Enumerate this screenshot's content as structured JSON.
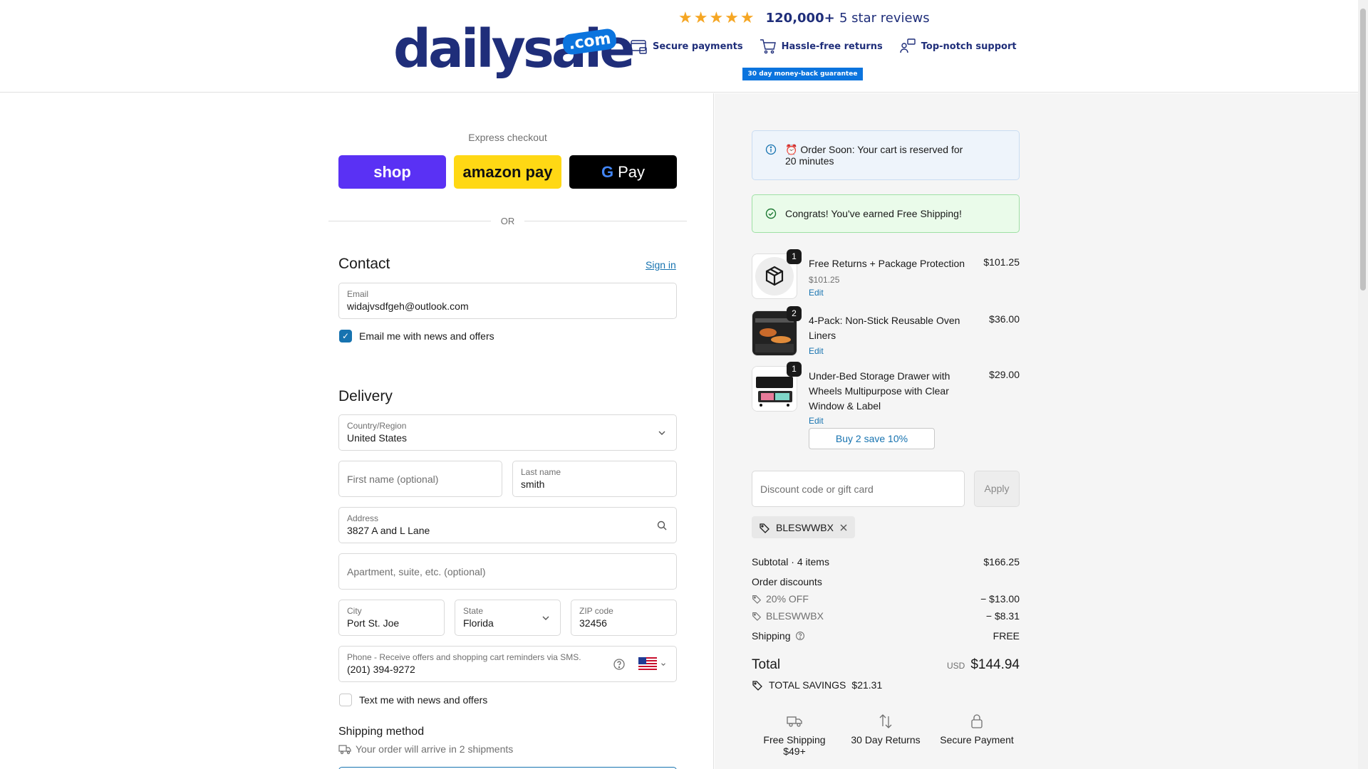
{
  "header": {
    "logo_text": "dailysale",
    "logo_badge": ".com",
    "stars": "★★★★★",
    "reviews_count": "120,000+",
    "reviews_suffix": "5 star reviews",
    "badges": [
      "Secure payments",
      "Hassle-free returns",
      "Top-notch support"
    ],
    "guarantee": "30 day money-back guarantee"
  },
  "express": {
    "label": "Express checkout",
    "shop": "shop",
    "amazon": "amazon pay",
    "google_g": "G",
    "google": "Pay",
    "or": "OR"
  },
  "contact": {
    "title": "Contact",
    "sign_in": "Sign in",
    "email_label": "Email",
    "email_value": "widajvsdfgeh@outlook.com",
    "news_label": "Email me with news and offers",
    "news_checked": true
  },
  "delivery": {
    "title": "Delivery",
    "country_label": "Country/Region",
    "country_value": "United States",
    "first_name_placeholder": "First name (optional)",
    "last_name_label": "Last name",
    "last_name_value": "smith",
    "address_label": "Address",
    "address_value": "3827 A and L Lane",
    "apt_placeholder": "Apartment, suite, etc. (optional)",
    "city_label": "City",
    "city_value": "Port St. Joe",
    "state_label": "State",
    "state_value": "Florida",
    "zip_label": "ZIP code",
    "zip_value": "32456",
    "phone_label": "Phone - Receive offers and shopping cart reminders via SMS.",
    "phone_value": "(201) 394-9272",
    "sms_label": "Text me with news and offers",
    "sms_checked": false
  },
  "shipping_method": {
    "title": "Shipping method",
    "note": "Your order will arrive in 2 shipments"
  },
  "notices": {
    "reserve": "⏰ Order Soon: Your cart is reserved for 20 minutes",
    "free_shipping": "Congrats! You've earned Free Shipping!"
  },
  "items": [
    {
      "name": "Free Returns + Package Protection",
      "qty": "1",
      "price": "$101.25",
      "sub": "$101.25",
      "edit": "Edit"
    },
    {
      "name": "4-Pack: Non-Stick Reusable Oven Liners",
      "qty": "2",
      "price": "$36.00",
      "edit": "Edit"
    },
    {
      "name": "Under-Bed Storage Drawer with Wheels Multipurpose with Clear Window & Label",
      "qty": "1",
      "price": "$29.00",
      "edit": "Edit"
    }
  ],
  "bundle_button": "Buy 2 save 10%",
  "discount": {
    "placeholder": "Discount code or gift card",
    "apply": "Apply",
    "applied_code": "BLESWWBX"
  },
  "summary": {
    "subtotal_label": "Subtotal · 4 items",
    "subtotal_value": "$166.25",
    "order_discounts_label": "Order discounts",
    "discount1_label": "20% OFF",
    "discount1_value": "− $13.00",
    "discount2_label": "BLESWWBX",
    "discount2_value": "− $8.31",
    "shipping_label": "Shipping",
    "shipping_value": "FREE",
    "total_label": "Total",
    "currency": "USD",
    "total_value": "$144.94",
    "savings_label": "TOTAL SAVINGS",
    "savings_value": "$21.31"
  },
  "trust": {
    "free_shipping": "Free Shipping $49+",
    "returns": "30 Day Returns",
    "secure": "Secure Payment"
  }
}
